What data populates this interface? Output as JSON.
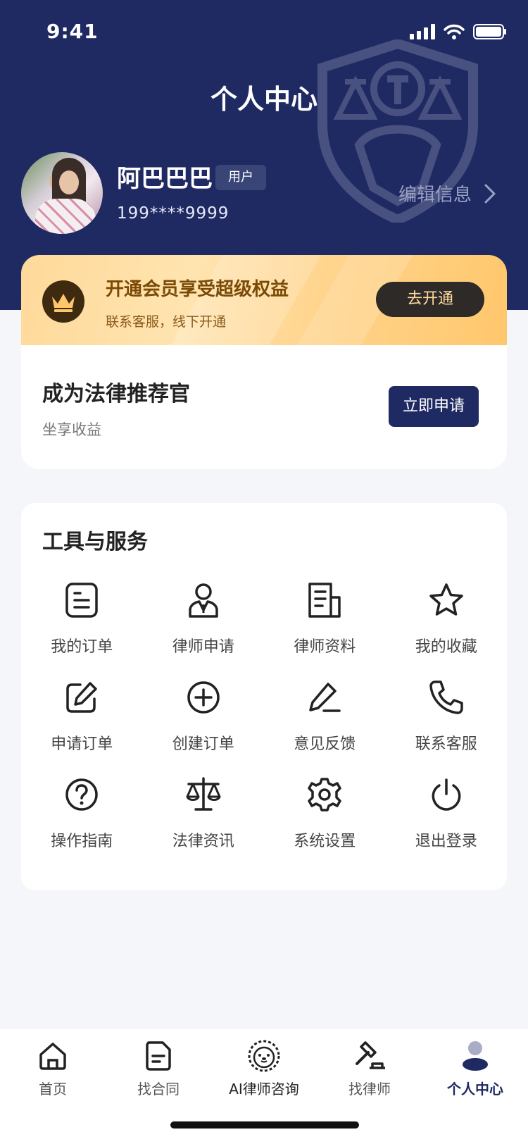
{
  "status_bar": {
    "time": "9:41"
  },
  "header": {
    "title": "个人中心"
  },
  "profile": {
    "name": "阿巴巴巴",
    "role": "用户",
    "phone": "199****9999",
    "edit_label": "编辑信息"
  },
  "vip": {
    "title": "开通会员享受超级权益",
    "subtitle": "联系客服，线下开通",
    "button": "去开通"
  },
  "referral": {
    "title": "成为法律推荐官",
    "subtitle": "坐享收益",
    "button": "立即申请"
  },
  "tools": {
    "title": "工具与服务",
    "items": [
      {
        "label": "我的订单",
        "icon": "order-icon"
      },
      {
        "label": "律师申请",
        "icon": "lawyer-icon"
      },
      {
        "label": "律师资料",
        "icon": "document-icon"
      },
      {
        "label": "我的收藏",
        "icon": "star-icon"
      },
      {
        "label": "申请订单",
        "icon": "edit-icon"
      },
      {
        "label": "创建订单",
        "icon": "plus-circle-icon"
      },
      {
        "label": "意见反馈",
        "icon": "pencil-icon"
      },
      {
        "label": "联系客服",
        "icon": "phone-icon"
      },
      {
        "label": "操作指南",
        "icon": "help-icon"
      },
      {
        "label": "法律资讯",
        "icon": "scales-icon"
      },
      {
        "label": "系统设置",
        "icon": "gear-icon"
      },
      {
        "label": "退出登录",
        "icon": "power-icon"
      }
    ]
  },
  "tabbar": {
    "items": [
      {
        "label": "首页",
        "icon": "home-icon"
      },
      {
        "label": "找合同",
        "icon": "contract-icon"
      },
      {
        "label": "AI律师咨询",
        "icon": "lion-icon"
      },
      {
        "label": "找律师",
        "icon": "gavel-icon"
      },
      {
        "label": "个人中心",
        "icon": "user-icon",
        "active": true
      }
    ]
  },
  "colors": {
    "primary": "#1f2a63",
    "gold": "#ffc76c",
    "background": "#f5f6f9"
  }
}
